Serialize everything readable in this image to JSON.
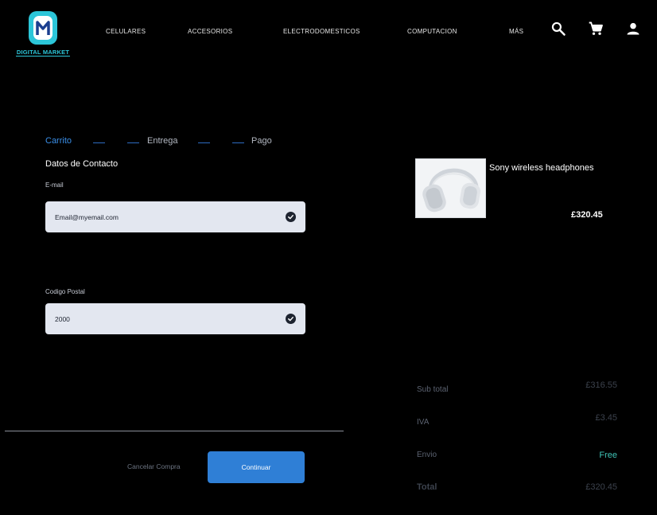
{
  "brand": {
    "name": "DIGITAL MARKET",
    "accent": "#2cc6d9"
  },
  "nav": {
    "items": [
      "CELULARES",
      "ACCESORIOS",
      "ELECTRODOMESTICOS",
      "COMPUTACION",
      "MÁS"
    ],
    "icons": [
      "search-icon",
      "cart-icon",
      "user-icon"
    ]
  },
  "checkout": {
    "steps": [
      "Carrito",
      "Entrega",
      "Pago"
    ],
    "active_step": "Carrito",
    "section_title": "Datos de Contacto",
    "email": {
      "label": "E-mail",
      "value": "Email@myemail.com"
    },
    "postal": {
      "label": "Codigo Postal",
      "value": "2000"
    },
    "cancel_label": "Cancelar Compra",
    "continue_label": "Continuar",
    "colors": {
      "primary": "#2f7fd6",
      "free": "#3fc3b6"
    }
  },
  "cart": {
    "product": {
      "name": "Sony wireless headphones",
      "price": "£320.45"
    },
    "summary": {
      "subtotal_label": "Sub total",
      "subtotal": "£316.55",
      "iva_label": "IVA",
      "iva": "£3.45",
      "envio_label": "Envio",
      "envio": "Free",
      "total_label": "Total",
      "total": "£320.45"
    }
  }
}
